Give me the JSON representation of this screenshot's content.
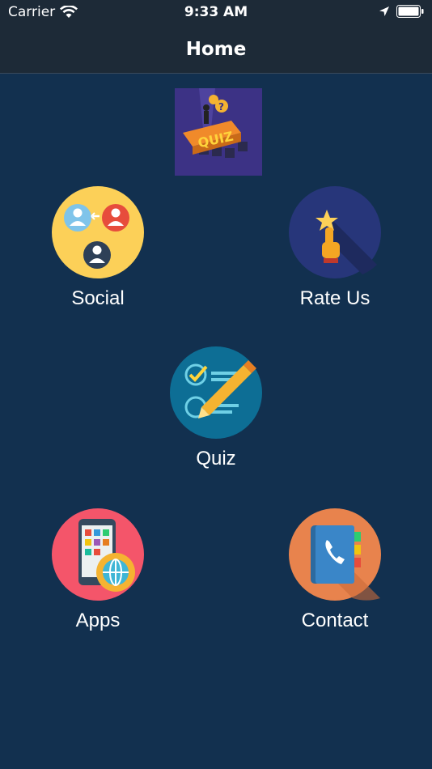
{
  "status_bar": {
    "carrier": "Carrier",
    "time": "9:33 AM"
  },
  "nav": {
    "title": "Home"
  },
  "tiles": [
    {
      "label": "Social",
      "icon": "social-icon"
    },
    {
      "label": "Rate Us",
      "icon": "rate-us-icon"
    },
    {
      "label": "Quiz",
      "icon": "quiz-icon"
    },
    {
      "label": "Apps",
      "icon": "apps-icon"
    },
    {
      "label": "Contact",
      "icon": "contact-icon"
    }
  ],
  "colors": {
    "background": "#12304f",
    "navbar": "#1d2a37",
    "social": "#fcd058",
    "rate_us": "#27367a",
    "quiz": "#0d6e95",
    "apps": "#f4556a",
    "contact": "#e8834d"
  }
}
